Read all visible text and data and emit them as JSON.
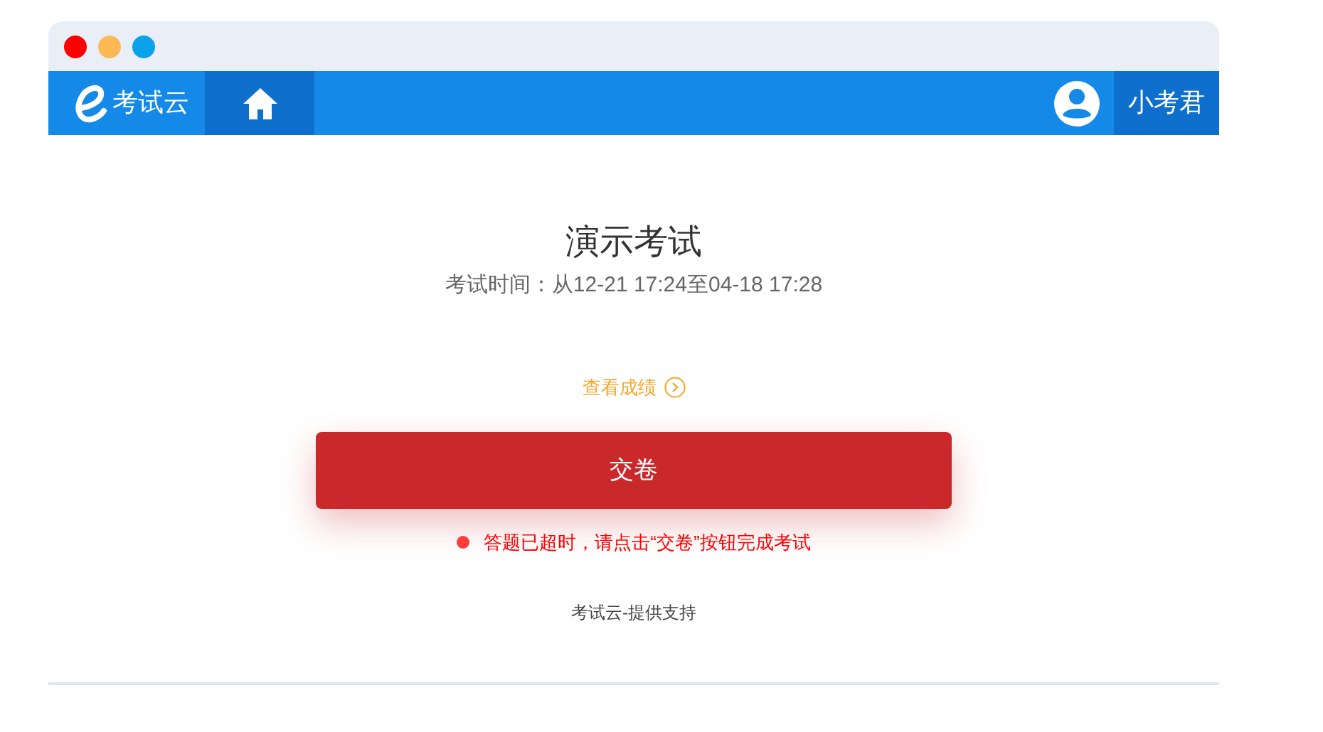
{
  "navbar": {
    "brand": "考试云",
    "user": "小考君"
  },
  "exam": {
    "title": "演示考试",
    "time": "考试时间：从12-21 17:24至04-18 17:28",
    "result_link": "查看成绩",
    "submit_button": "交卷",
    "warning": "答题已超时，请点击“交卷”按钮完成考试"
  },
  "footer": "考试云-提供支持"
}
